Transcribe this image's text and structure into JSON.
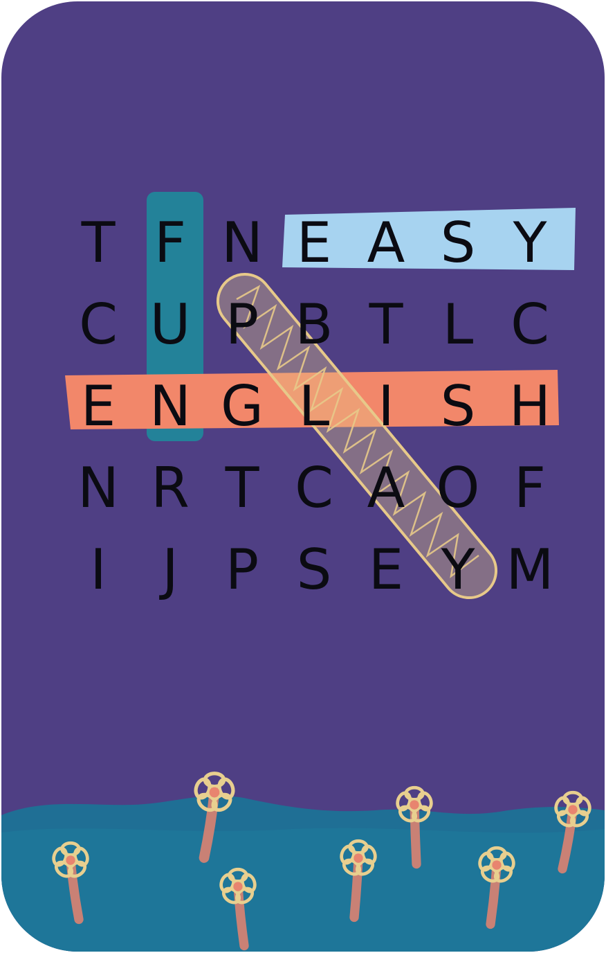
{
  "puzzle": {
    "grid": [
      [
        "T",
        "F",
        "N",
        "E",
        "A",
        "S",
        "Y"
      ],
      [
        "C",
        "U",
        "P",
        "B",
        "T",
        "L",
        "C"
      ],
      [
        "E",
        "N",
        "G",
        "L",
        "I",
        "S",
        "H"
      ],
      [
        "N",
        "R",
        "T",
        "C",
        "A",
        "O",
        "F"
      ],
      [
        "I",
        "J",
        "P",
        "S",
        "E",
        "Y",
        "M"
      ]
    ],
    "found_words": [
      {
        "word": "EASY",
        "direction": "horizontal",
        "color": "#a7d3f0"
      },
      {
        "word": "ENGLISH",
        "direction": "horizontal",
        "color": "#f2876a"
      },
      {
        "word": "FUN",
        "direction": "vertical",
        "color": "#1e8a9b"
      },
      {
        "word": "PLAY",
        "direction": "diagonal",
        "color": "#e7c98a"
      }
    ]
  },
  "colors": {
    "background": "#4f3f84",
    "grass": "#1f6f95",
    "flower_petal": "#e8cf8f",
    "flower_stem": "#e8846f",
    "letters": "#0b0b12"
  }
}
